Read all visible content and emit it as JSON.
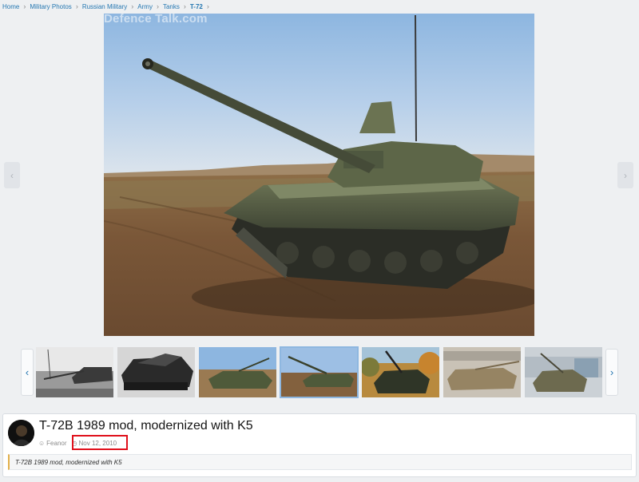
{
  "breadcrumb": [
    {
      "label": "Home"
    },
    {
      "label": "Military Photos"
    },
    {
      "label": "Russian Military"
    },
    {
      "label": "Army"
    },
    {
      "label": "Tanks"
    },
    {
      "label": "T-72",
      "current": true
    }
  ],
  "photo": {
    "watermark": "Defence Talk.com"
  },
  "icons": {
    "prev": "chevron-left-icon",
    "next": "chevron-right-icon",
    "user": "user-icon",
    "clock": "clock-icon"
  },
  "thumbnails": {
    "count": 7,
    "active_index": 3
  },
  "media": {
    "title": "T-72B 1989 mod, modernized with K5",
    "author": "Feanor",
    "date": "Nov 12, 2010",
    "description": "T-72B 1989 mod, modernized with K5"
  },
  "colors": {
    "link": "#2577b1",
    "highlight_box": "#e0101b",
    "quote_bar": "#e2b04a"
  }
}
